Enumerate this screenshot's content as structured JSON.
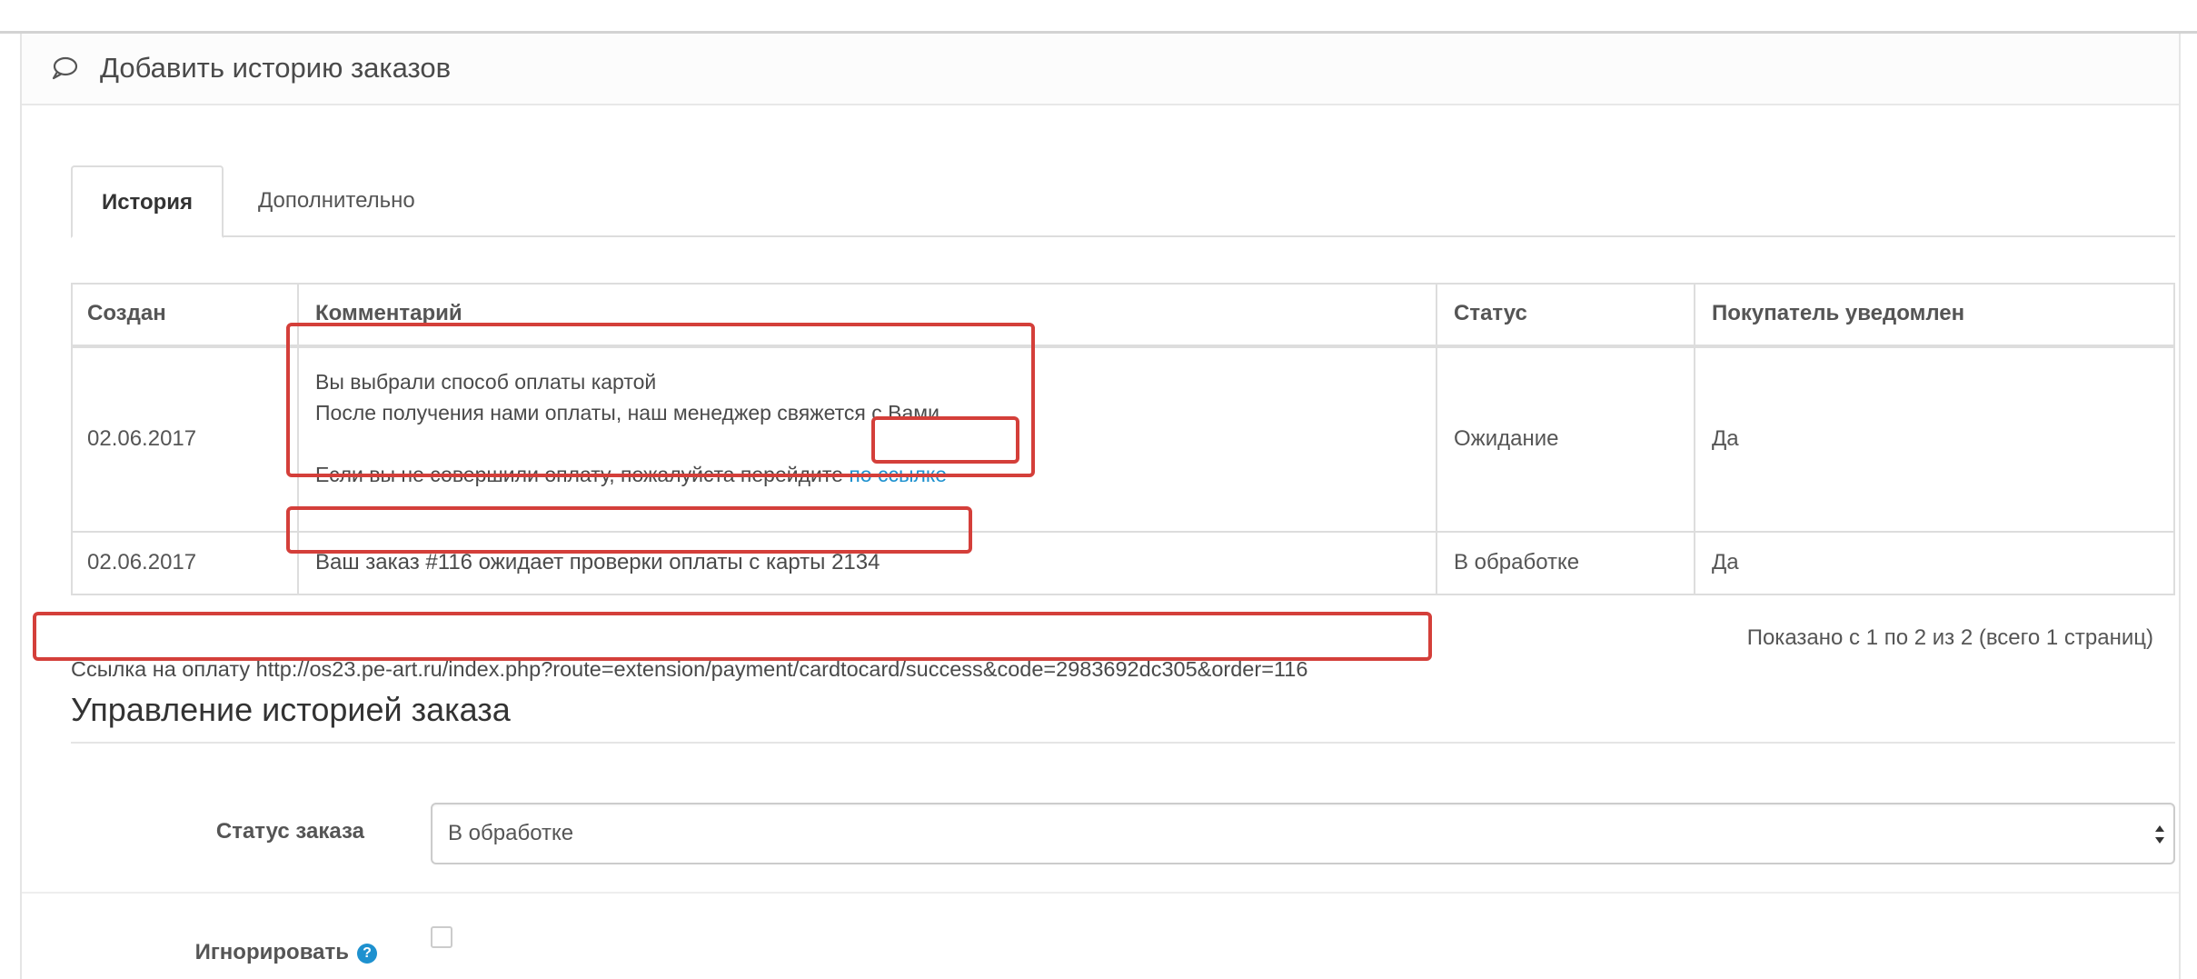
{
  "panel": {
    "title": "Добавить историю заказов",
    "icon": "comment-icon"
  },
  "tabs": [
    {
      "label": "История",
      "active": true
    },
    {
      "label": "Дополнительно",
      "active": false
    }
  ],
  "history_table": {
    "headers": [
      "Создан",
      "Комментарий",
      "Статус",
      "Покупатель уведомлен"
    ],
    "rows": [
      {
        "date": "02.06.2017",
        "comment_lines": [
          "Вы выбрали способ оплаты картой",
          "После получения нами оплаты, наш менеджер свяжется с Вами.",
          "",
          "Если вы не совершили оплату, пожалуйста перейдите"
        ],
        "comment_link": "по ссылке",
        "status": "Ожидание",
        "notified": "Да"
      },
      {
        "date": "02.06.2017",
        "comment": "Ваш заказ #116 ожидает проверки оплаты с карты 2134",
        "status": "В обработке",
        "notified": "Да"
      }
    ]
  },
  "pagination_info": "Показано с 1 по 2 из 2 (всего 1 страниц)",
  "payment_link_text": "Ссылка на оплату http://os23.pe-art.ru/index.php?route=extension/payment/cardtocard/success&code=2983692dc305&order=116",
  "manage_section": {
    "title": "Управление историей заказа",
    "status_label": "Статус заказа",
    "status_value": "В обработке",
    "ignore_label": "Игнорировать",
    "ignore_checked": false
  },
  "colors": {
    "highlight_box": "#d43f3a",
    "link": "#1e91cf"
  }
}
